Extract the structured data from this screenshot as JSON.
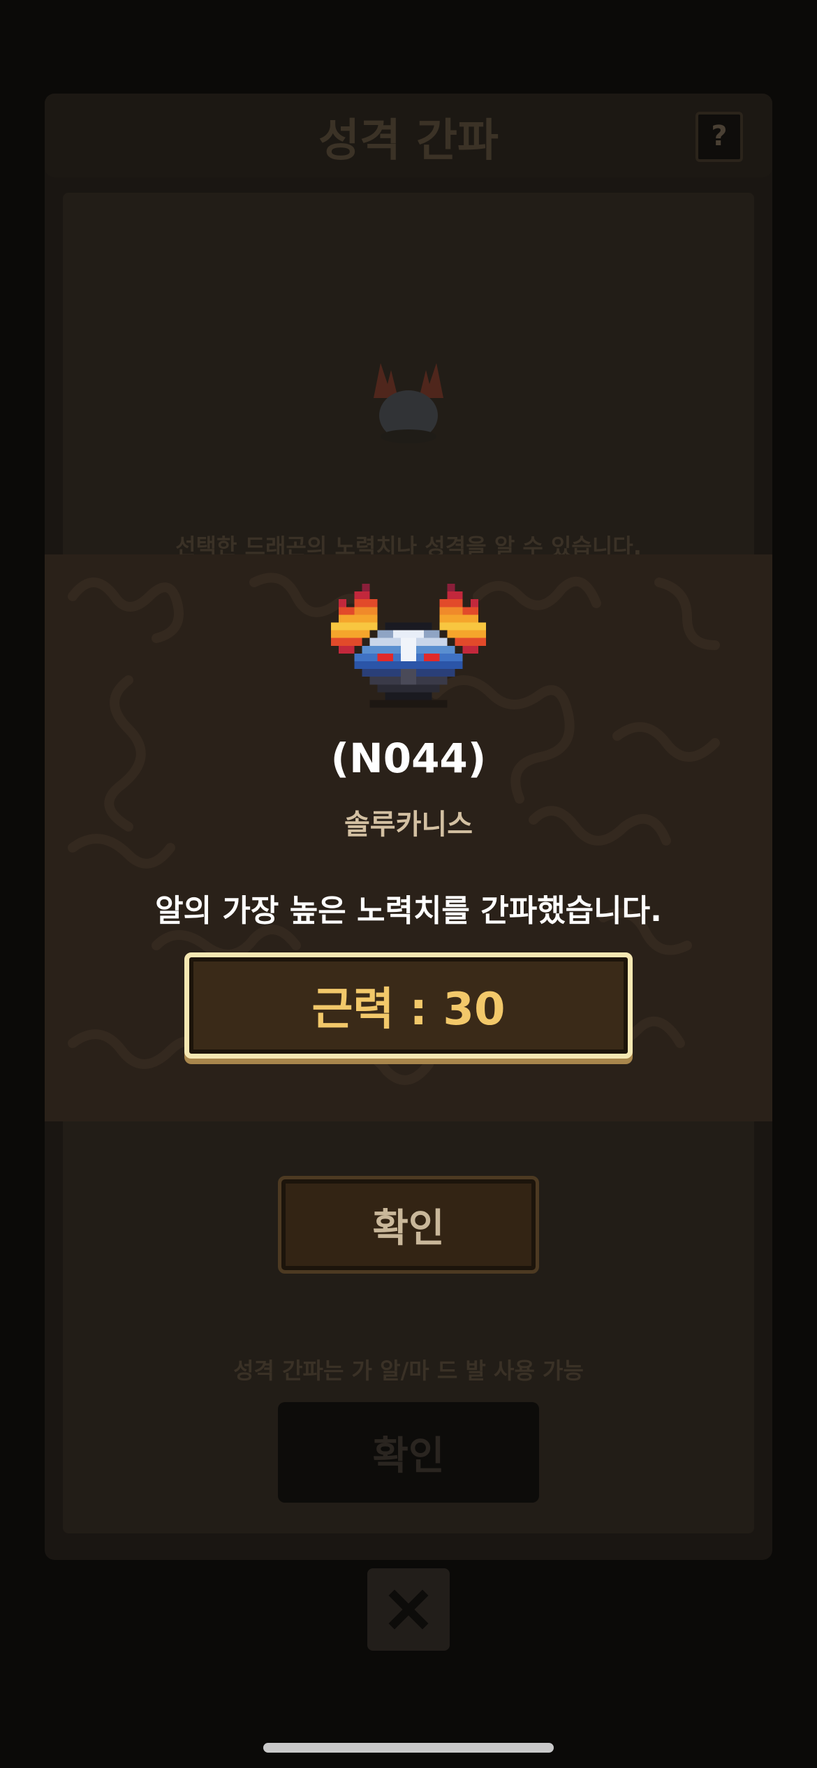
{
  "background_screen": {
    "title": "성격 간파",
    "help_label": "?",
    "description": "선택한 드래곤의 노력치나 성격을 알 수 있습니다.",
    "confirm_label": "확인",
    "usage_note": "성격 간파는 가 알/마 드 발 사용 가능",
    "confirm2_label": "확인",
    "close_icon": "close-x-icon"
  },
  "popup": {
    "dragon_code": "(N044)",
    "dragon_name": "솔루카니스",
    "result_message": "알의 가장 높은 노력치를 간파했습니다.",
    "stat_label": "근력 : 30"
  },
  "colors": {
    "accent_gold": "#f2c86a",
    "popup_bg": "#2a2119",
    "stat_border": "#f5e7b2"
  }
}
